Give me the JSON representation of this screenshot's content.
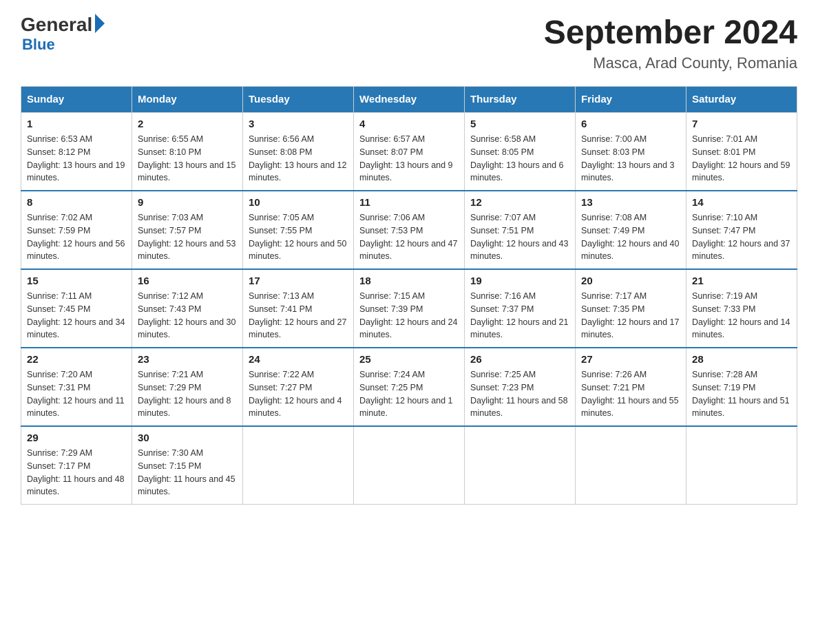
{
  "header": {
    "logo_general": "General",
    "logo_blue": "Blue",
    "title": "September 2024",
    "subtitle": "Masca, Arad County, Romania"
  },
  "weekdays": [
    "Sunday",
    "Monday",
    "Tuesday",
    "Wednesday",
    "Thursday",
    "Friday",
    "Saturday"
  ],
  "weeks": [
    [
      {
        "day": "1",
        "sunrise": "6:53 AM",
        "sunset": "8:12 PM",
        "daylight": "13 hours and 19 minutes."
      },
      {
        "day": "2",
        "sunrise": "6:55 AM",
        "sunset": "8:10 PM",
        "daylight": "13 hours and 15 minutes."
      },
      {
        "day": "3",
        "sunrise": "6:56 AM",
        "sunset": "8:08 PM",
        "daylight": "13 hours and 12 minutes."
      },
      {
        "day": "4",
        "sunrise": "6:57 AM",
        "sunset": "8:07 PM",
        "daylight": "13 hours and 9 minutes."
      },
      {
        "day": "5",
        "sunrise": "6:58 AM",
        "sunset": "8:05 PM",
        "daylight": "13 hours and 6 minutes."
      },
      {
        "day": "6",
        "sunrise": "7:00 AM",
        "sunset": "8:03 PM",
        "daylight": "13 hours and 3 minutes."
      },
      {
        "day": "7",
        "sunrise": "7:01 AM",
        "sunset": "8:01 PM",
        "daylight": "12 hours and 59 minutes."
      }
    ],
    [
      {
        "day": "8",
        "sunrise": "7:02 AM",
        "sunset": "7:59 PM",
        "daylight": "12 hours and 56 minutes."
      },
      {
        "day": "9",
        "sunrise": "7:03 AM",
        "sunset": "7:57 PM",
        "daylight": "12 hours and 53 minutes."
      },
      {
        "day": "10",
        "sunrise": "7:05 AM",
        "sunset": "7:55 PM",
        "daylight": "12 hours and 50 minutes."
      },
      {
        "day": "11",
        "sunrise": "7:06 AM",
        "sunset": "7:53 PM",
        "daylight": "12 hours and 47 minutes."
      },
      {
        "day": "12",
        "sunrise": "7:07 AM",
        "sunset": "7:51 PM",
        "daylight": "12 hours and 43 minutes."
      },
      {
        "day": "13",
        "sunrise": "7:08 AM",
        "sunset": "7:49 PM",
        "daylight": "12 hours and 40 minutes."
      },
      {
        "day": "14",
        "sunrise": "7:10 AM",
        "sunset": "7:47 PM",
        "daylight": "12 hours and 37 minutes."
      }
    ],
    [
      {
        "day": "15",
        "sunrise": "7:11 AM",
        "sunset": "7:45 PM",
        "daylight": "12 hours and 34 minutes."
      },
      {
        "day": "16",
        "sunrise": "7:12 AM",
        "sunset": "7:43 PM",
        "daylight": "12 hours and 30 minutes."
      },
      {
        "day": "17",
        "sunrise": "7:13 AM",
        "sunset": "7:41 PM",
        "daylight": "12 hours and 27 minutes."
      },
      {
        "day": "18",
        "sunrise": "7:15 AM",
        "sunset": "7:39 PM",
        "daylight": "12 hours and 24 minutes."
      },
      {
        "day": "19",
        "sunrise": "7:16 AM",
        "sunset": "7:37 PM",
        "daylight": "12 hours and 21 minutes."
      },
      {
        "day": "20",
        "sunrise": "7:17 AM",
        "sunset": "7:35 PM",
        "daylight": "12 hours and 17 minutes."
      },
      {
        "day": "21",
        "sunrise": "7:19 AM",
        "sunset": "7:33 PM",
        "daylight": "12 hours and 14 minutes."
      }
    ],
    [
      {
        "day": "22",
        "sunrise": "7:20 AM",
        "sunset": "7:31 PM",
        "daylight": "12 hours and 11 minutes."
      },
      {
        "day": "23",
        "sunrise": "7:21 AM",
        "sunset": "7:29 PM",
        "daylight": "12 hours and 8 minutes."
      },
      {
        "day": "24",
        "sunrise": "7:22 AM",
        "sunset": "7:27 PM",
        "daylight": "12 hours and 4 minutes."
      },
      {
        "day": "25",
        "sunrise": "7:24 AM",
        "sunset": "7:25 PM",
        "daylight": "12 hours and 1 minute."
      },
      {
        "day": "26",
        "sunrise": "7:25 AM",
        "sunset": "7:23 PM",
        "daylight": "11 hours and 58 minutes."
      },
      {
        "day": "27",
        "sunrise": "7:26 AM",
        "sunset": "7:21 PM",
        "daylight": "11 hours and 55 minutes."
      },
      {
        "day": "28",
        "sunrise": "7:28 AM",
        "sunset": "7:19 PM",
        "daylight": "11 hours and 51 minutes."
      }
    ],
    [
      {
        "day": "29",
        "sunrise": "7:29 AM",
        "sunset": "7:17 PM",
        "daylight": "11 hours and 48 minutes."
      },
      {
        "day": "30",
        "sunrise": "7:30 AM",
        "sunset": "7:15 PM",
        "daylight": "11 hours and 45 minutes."
      },
      null,
      null,
      null,
      null,
      null
    ]
  ]
}
